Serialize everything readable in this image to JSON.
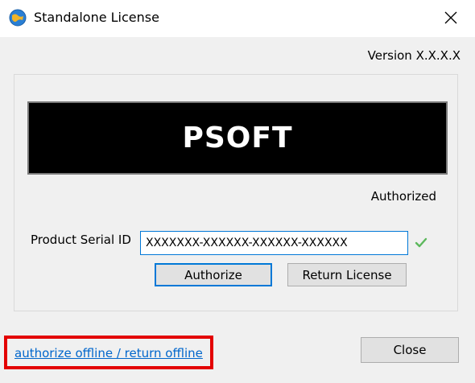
{
  "window": {
    "title": "Standalone License",
    "icon": "app-globe-icon",
    "close_icon": "close-icon"
  },
  "version_text": "Version X.X.X.X",
  "logo_text": "PSOFT",
  "status_text": "Authorized",
  "serial": {
    "label": "Product Serial ID",
    "value": "XXXXXXX-XXXXXX-XXXXXX-XXXXXX",
    "status_icon": "check-icon"
  },
  "buttons": {
    "authorize": "Authorize",
    "return_license": "Return License",
    "close": "Close"
  },
  "offline_link": "authorize offline / return offline",
  "colors": {
    "link": "#0066cc",
    "highlight": "#e30000",
    "check": "#5cb85c",
    "focus": "#0078d7"
  }
}
